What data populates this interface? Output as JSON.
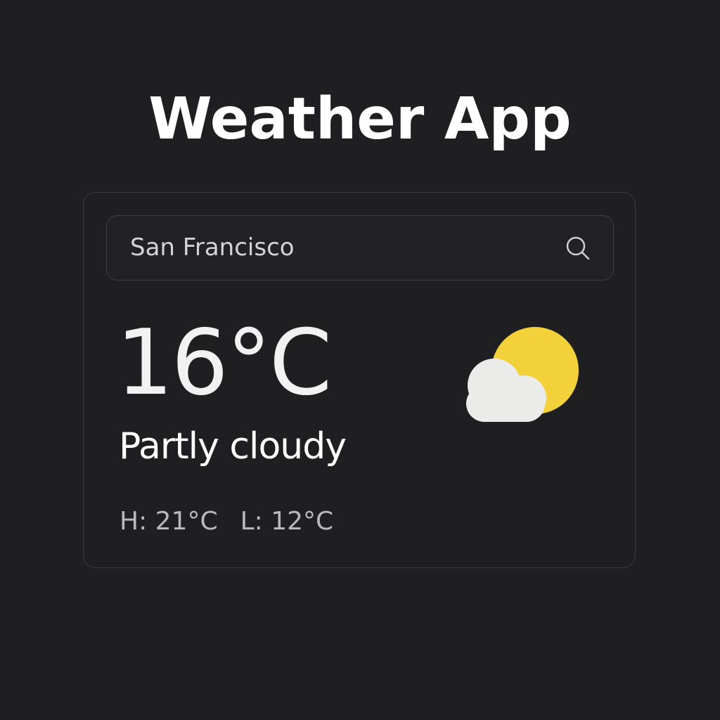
{
  "app": {
    "title": "Weather App"
  },
  "search": {
    "value": "San Francisco",
    "placeholder": "San Francisco",
    "icon": "search-icon"
  },
  "current": {
    "temperature": "16°C",
    "condition": "Partly cloudy",
    "condition_icon": "partly-cloudy-icon",
    "high": "H: 21°C",
    "low": "L: 12°C"
  },
  "colors": {
    "background": "#1f1f21",
    "card_border": "#3b3b3f",
    "sun": "#f2d13a",
    "cloud": "#ebebea",
    "text_primary": "#ffffff",
    "text_secondary": "#b9b9bd"
  }
}
